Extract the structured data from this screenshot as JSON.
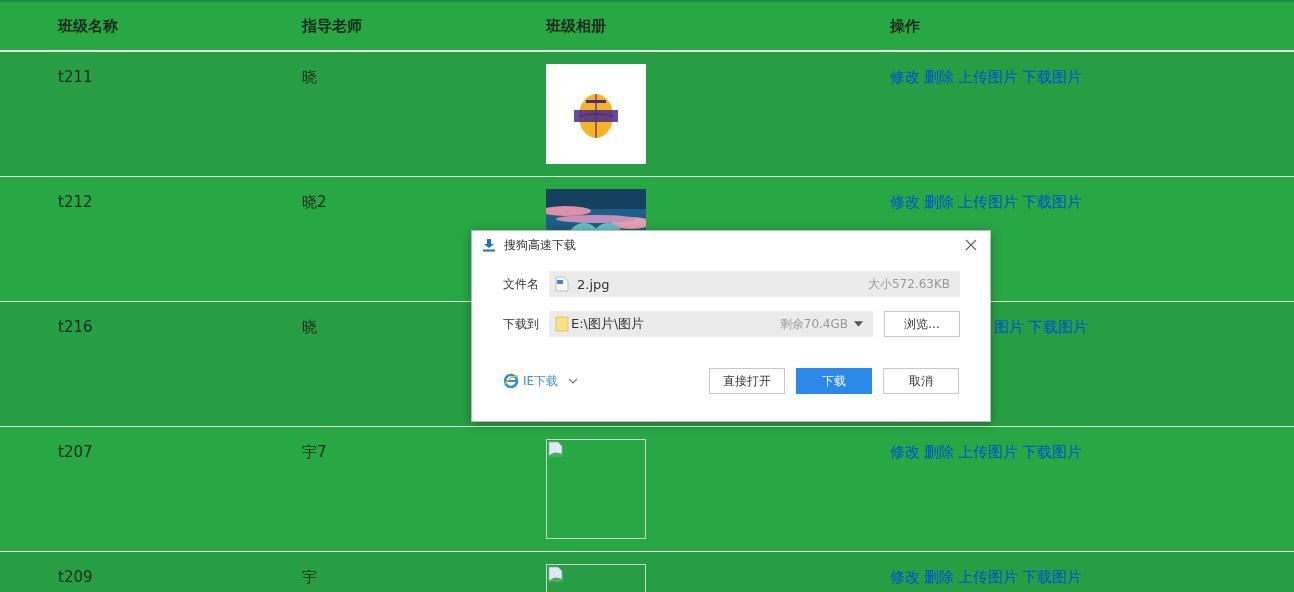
{
  "table": {
    "columns": [
      "班级名称",
      "指导老师",
      "班级相册",
      "操作"
    ],
    "rows": [
      {
        "name": "t211",
        "teacher": "晓",
        "image": {
          "kind": "logo"
        },
        "actions": [
          "修改",
          "删除",
          "上传图片",
          "下载图片"
        ]
      },
      {
        "name": "t212",
        "teacher": "晓2",
        "image": {
          "kind": "picture"
        },
        "actions": [
          "修改",
          "删除",
          "上传图片",
          "下载图片"
        ]
      },
      {
        "name": "t216",
        "teacher": "晓",
        "actions_cut": true,
        "actions": [
          "图片",
          "下载图片"
        ]
      },
      {
        "name": "t207",
        "teacher": "宇7",
        "image": {
          "kind": "broken"
        },
        "actions": [
          "修改",
          "删除",
          "上传图片",
          "下载图片"
        ]
      },
      {
        "name": "t209",
        "teacher": "宇",
        "image": {
          "kind": "broken"
        },
        "actions": [
          "修改",
          "删除",
          "上传图片",
          "下载图片"
        ]
      }
    ]
  },
  "dialog": {
    "title": "搜狗高速下载",
    "fields": [
      {
        "kind": "file",
        "label": "文件名",
        "value": "2.jpg",
        "info": "大小572.63KB"
      },
      {
        "kind": "folder",
        "label": "下载到",
        "value": "E:\\图片\\图片",
        "info": "剩余70.4GB",
        "button": "浏览..."
      }
    ],
    "ie_link": "IE下载",
    "buttons": [
      {
        "label": "直接打开",
        "primary": false
      },
      {
        "label": "下载",
        "primary": true
      },
      {
        "label": "取消",
        "primary": false
      }
    ]
  }
}
